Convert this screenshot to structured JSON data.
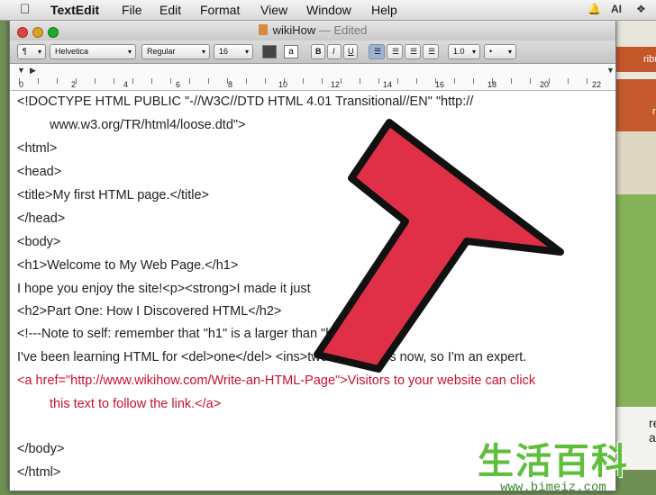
{
  "menubar": {
    "app_name": "TextEdit",
    "items": [
      "File",
      "Edit",
      "Format",
      "View",
      "Window",
      "Help"
    ],
    "tray": "AI"
  },
  "window": {
    "title": "wikiHow",
    "status": "Edited"
  },
  "toolbar": {
    "style": "¶",
    "font_family": "Helvetica",
    "font_style": "Regular",
    "font_size": "16",
    "bold": "B",
    "italic": "I",
    "underline": "U",
    "spacing": "1.0",
    "list": "•"
  },
  "ruler": {
    "numbers": [
      "0",
      "2",
      "4",
      "6",
      "8",
      "10",
      "12",
      "14",
      "16",
      "18",
      "20",
      "22"
    ]
  },
  "document": {
    "lines": [
      "<!DOCTYPE HTML PUBLIC \"-//W3C//DTD HTML 4.01 Transitional//EN\" \"http://",
      "www.w3.org/TR/html4/loose.dtd\">",
      "<html>",
      "<head>",
      "<title>My first HTML page.</title>",
      "</head>",
      "<body>",
      "<h1>Welcome to My Web Page.</h1>",
      "I hope you enjoy the site!<p><strong>I made it just",
      "<h2>Part One: How I Discovered HTML</h2>",
      "<!---Note to self: remember that \"h1\" is a larger              than \"h2\"--->",
      "I've been learning HTML for <del>one</del> <ins>two</ins>hours now, so I'm an expert.",
      "<a href=\"http://www.wikihow.com/Write-an-HTML-Page\">Visitors to your website can click",
      "this text to follow the link.</a>",
      "</body>",
      "</html>"
    ]
  },
  "background_page": {
    "orange_label": "ributes",
    "red_label": "reques",
    "white_label": "reate a"
  },
  "watermark": {
    "chars": "生活百科",
    "url": "www.bimeiz.com"
  },
  "colors": {
    "link_red": "#c8102e",
    "arrow_red": "#e03048"
  }
}
